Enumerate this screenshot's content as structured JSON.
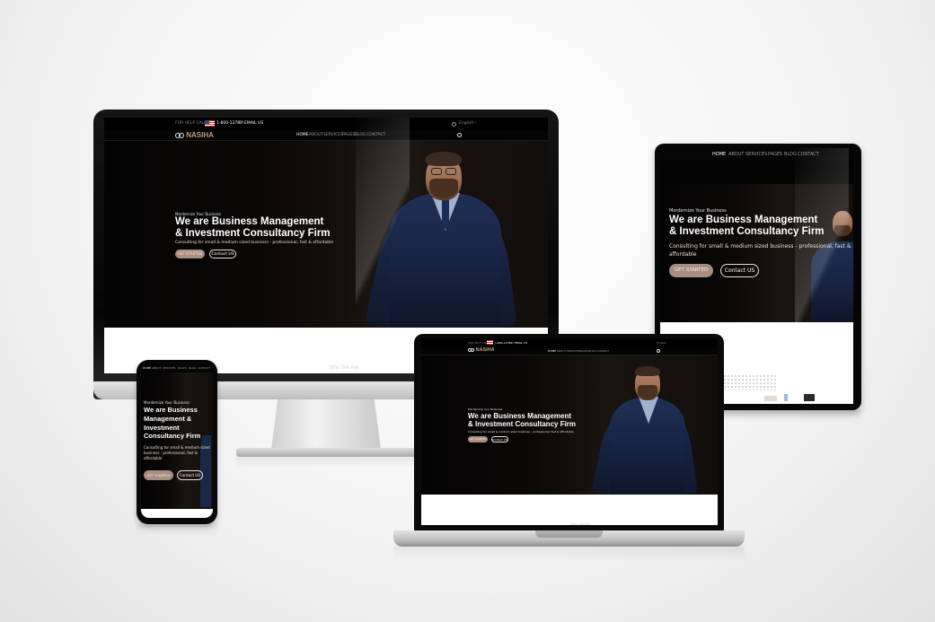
{
  "site": {
    "logo_text": "NASIHA",
    "topbar": {
      "help_prefix": "FOR HELP CALL",
      "phone": "1-800-12789",
      "or_text": "OR",
      "email_label": "EMAIL US",
      "language": "English"
    },
    "nav": [
      "HOME",
      "ABOUT",
      "SERVICES",
      "PAGES",
      "BLOG",
      "CONTACT"
    ],
    "hero": {
      "kicker": "Mordernize Your Business",
      "headline_line1": "We are Business Management",
      "headline_line2": "& Investment Consultancy Firm",
      "subline": "Consulting for small & medium sized business - professional, fast & affordable",
      "primary_button": "GET STARTED",
      "secondary_button": "Contact US"
    },
    "next_section_heading": "Who We Are"
  },
  "phone_hero": {
    "headline_line1": "We are Business",
    "headline_line2": "Management &",
    "headline_line3": "Investment",
    "headline_line4": "Consultancy Firm",
    "subline_line1": "Consulting for small & medium sized",
    "subline_line2": "business - professional, fast &",
    "subline_line3": "affordable"
  },
  "tablet_hero": {
    "subline_line1": "Consulting for small & medium sized business - professional, fast &",
    "subline_line2": "affordable"
  },
  "colors": {
    "accent": "#a88d80",
    "logo": "#c39a7c",
    "hero_bg": "#0b0807",
    "suit": "#1f2f55"
  },
  "icons": {
    "flag": "us-flag-icon",
    "globe": "globe-icon",
    "chevron": "chevron-down-icon",
    "search": "search-icon",
    "logo_mark": "logo-infinity-icon"
  }
}
